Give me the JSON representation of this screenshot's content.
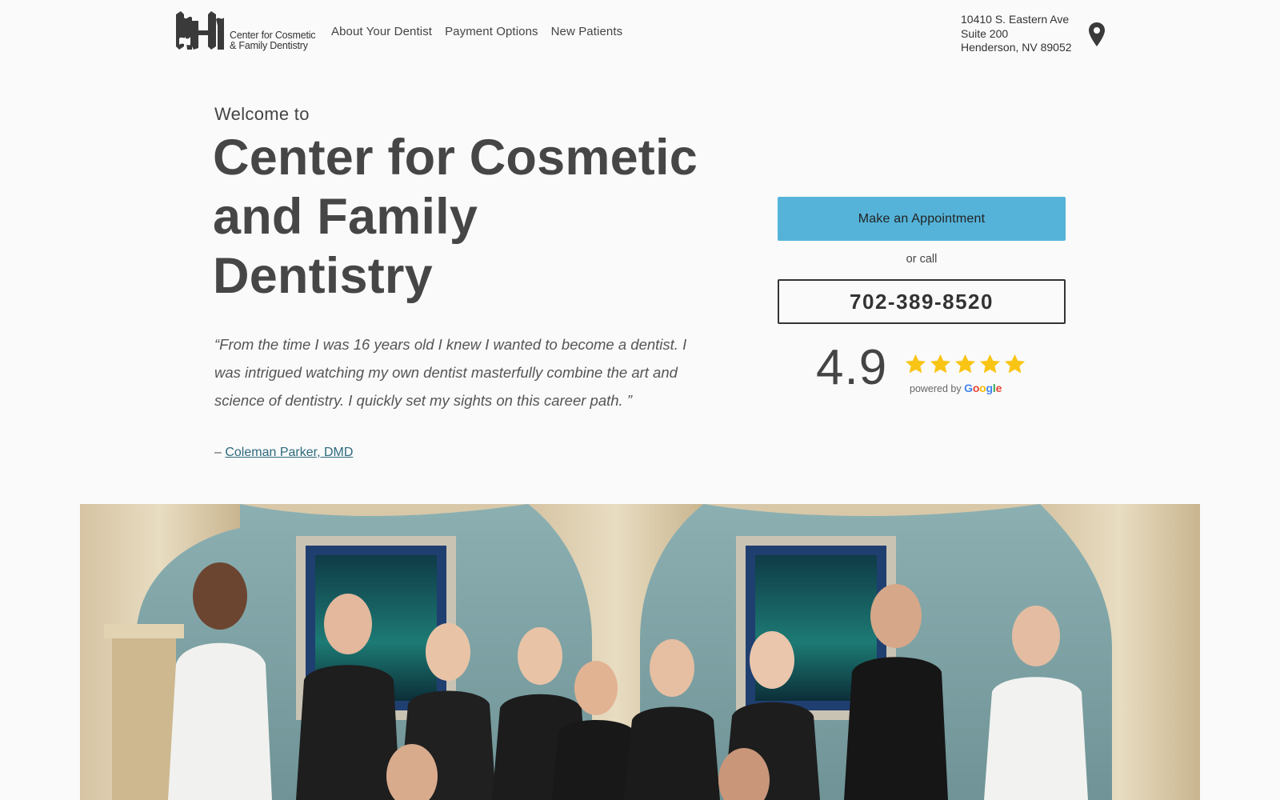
{
  "logo": {
    "line1": "Center for Cosmetic",
    "line2": "& Family Dentistry"
  },
  "nav": [
    {
      "label": "About Your Dentist"
    },
    {
      "label": "Payment Options"
    },
    {
      "label": "New Patients"
    }
  ],
  "address": {
    "line1": "10410 S. Eastern Ave",
    "line2": "Suite 200",
    "line3": "Henderson, NV 89052",
    "icon": "location-pin-icon"
  },
  "hero": {
    "welcome": "Welcome to",
    "title": "Center for Cosmetic and Family Dentistry",
    "quote": "“From the time I was 16 years old I knew I wanted to become a dentist.  I was intrigued watching my own dentist masterfully combine the art and science of dentistry.  I quickly set my sights on this career path. ”",
    "attribution_prefix": "– ",
    "attribution_name": "Coleman Parker, DMD"
  },
  "cta": {
    "appointment_label": "Make an Appointment",
    "or_call": "or call",
    "phone": "702-389-8520"
  },
  "rating": {
    "value": "4.9",
    "stars": 5,
    "powered_by": "powered by",
    "google": [
      "G",
      "o",
      "o",
      "g",
      "l",
      "e"
    ]
  },
  "colors": {
    "accent": "#55b3d9",
    "star": "#f9c515",
    "text": "#444444",
    "link": "#2d6a7d"
  }
}
